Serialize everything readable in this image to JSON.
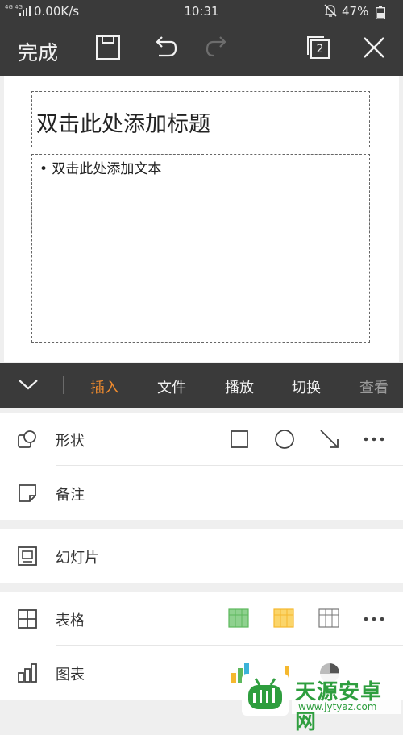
{
  "status_bar": {
    "network_label": "4G 4G",
    "speed": "0.00K/s",
    "time": "10:31",
    "battery": "47%"
  },
  "toolbar": {
    "done_label": "完成",
    "page_count": "2"
  },
  "slide": {
    "title_placeholder": "双击此处添加标题",
    "body_placeholder": "• 双击此处添加文本"
  },
  "tabs": [
    {
      "label": "插入",
      "active": true
    },
    {
      "label": "文件",
      "active": false
    },
    {
      "label": "播放",
      "active": false
    },
    {
      "label": "切换",
      "active": false
    },
    {
      "label": "查看",
      "active": false
    }
  ],
  "insert_panel": {
    "shape": {
      "label": "形状",
      "options": [
        "square-icon",
        "circle-icon",
        "arrow-line-icon",
        "more-icon"
      ]
    },
    "note": {
      "label": "备注"
    },
    "slide": {
      "label": "幻灯片"
    },
    "table": {
      "label": "表格",
      "options": [
        "green-table-icon",
        "yellow-table-icon",
        "gray-table-icon",
        "more-icon"
      ]
    },
    "chart": {
      "label": "图表",
      "options": [
        "bar-chart-icon",
        "column-chart-icon",
        "pie-chart-icon",
        "more-icon"
      ]
    }
  },
  "watermark": {
    "name": "天源安卓网",
    "url": "www.jytyaz.com"
  },
  "colors": {
    "dark_bar": "#3a3a3a",
    "active_tab": "#f08b2e",
    "table_green": "#5cb85c",
    "table_yellow": "#f5b82e",
    "watermark_green": "#2e9e3e"
  }
}
